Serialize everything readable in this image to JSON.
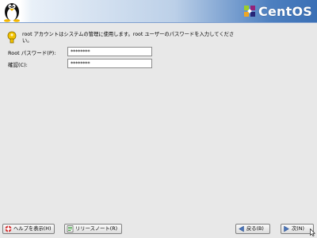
{
  "header": {
    "logo_text": "CentOS"
  },
  "info": {
    "text": "root アカウントはシステムの管理に使用します。root ユーザーのパスワードを入力してください。"
  },
  "fields": {
    "password": {
      "label": "Root パスワード(P):",
      "value": "********"
    },
    "confirm": {
      "label": "確認(C):",
      "value": "********"
    }
  },
  "footer": {
    "help_label": "ヘルプを表示(H)",
    "release_notes_label": "リリースノート(R)",
    "back_label": "戻る(B)",
    "next_label": "次(N)"
  },
  "colors": {
    "header_blue": "#3a6fb5",
    "background": "#e8e8e8"
  },
  "icons": [
    "tux-icon",
    "centos-logo-icon",
    "key-icon",
    "help-icon",
    "release-notes-icon",
    "back-arrow-icon",
    "next-arrow-icon"
  ]
}
